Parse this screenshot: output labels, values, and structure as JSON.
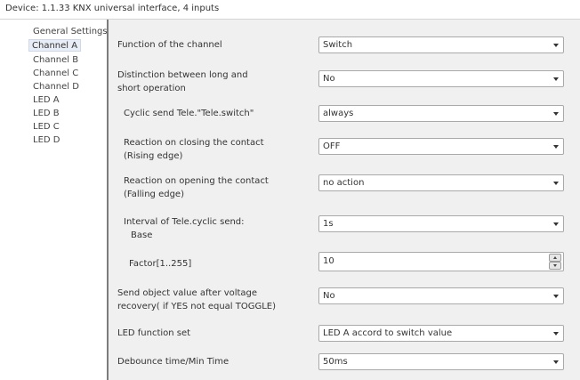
{
  "window": {
    "title": "Device: 1.1.33  KNX universal interface, 4 inputs"
  },
  "sidebar": {
    "items": [
      {
        "label": "General Settings",
        "selected": false
      },
      {
        "label": "Channel A",
        "selected": true
      },
      {
        "label": "Channel B",
        "selected": false
      },
      {
        "label": "Channel C",
        "selected": false
      },
      {
        "label": "Channel D",
        "selected": false
      },
      {
        "label": "LED A",
        "selected": false
      },
      {
        "label": "LED B",
        "selected": false
      },
      {
        "label": "LED C",
        "selected": false
      },
      {
        "label": "LED D",
        "selected": false
      }
    ]
  },
  "params": [
    {
      "label": "Function of the channel",
      "value": "Switch"
    },
    {
      "label_line1": "Distinction between long and",
      "label_line2": "short operation",
      "value": "No"
    },
    {
      "label": "Cyclic send Tele.\"Tele.switch\"",
      "value": "always"
    },
    {
      "label_line1": "Reaction on closing the contact",
      "label_line2": "(Rising edge)",
      "value": "OFF"
    },
    {
      "label_line1": "Reaction on opening the contact",
      "label_line2": "(Falling edge)",
      "value": "no action"
    },
    {
      "label_line1": "Interval of Tele.cyclic send:",
      "label_line2": "Base",
      "value": "1s"
    },
    {
      "label": "Factor[1..255]",
      "value": "10"
    },
    {
      "label_line1": "Send object value after voltage",
      "label_line2": "recovery( if YES not equal TOGGLE)",
      "value": "No"
    },
    {
      "label": "LED function set",
      "value": "LED A accord to switch value"
    },
    {
      "label": "Debounce time/Min Time",
      "value": "50ms"
    }
  ]
}
